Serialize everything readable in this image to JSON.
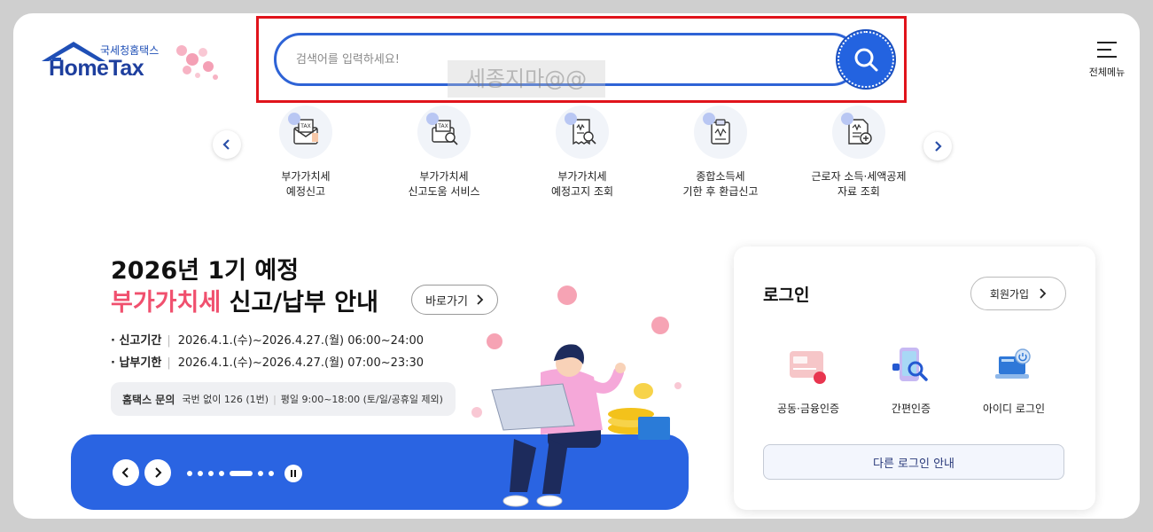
{
  "logo": {
    "sub": "국세청홈택스",
    "main": "HomeTax"
  },
  "search": {
    "placeholder": "검색어를 입력하세요!",
    "watermark": "세종지마@@"
  },
  "menu": {
    "label": "전체메뉴"
  },
  "quick_menu": [
    {
      "label": "부가가치세\n예정신고",
      "icon": "tax-envelope-icon"
    },
    {
      "label": "부가가치세\n신고도움 서비스",
      "icon": "tax-search-icon"
    },
    {
      "label": "부가가치세\n예정고지 조회",
      "icon": "receipt-search-icon"
    },
    {
      "label": "종합소득세\n기한 후 환급신고",
      "icon": "clipboard-icon"
    },
    {
      "label": "근로자 소득·세액공제\n자료 조회",
      "icon": "document-plus-icon"
    }
  ],
  "banner": {
    "title_line1": "2026년 1기 예정",
    "title_accent": "부가가치세",
    "title_rest": " 신고/납부 안내",
    "shortcut_label": "바로가기",
    "report_period_label": "신고기간",
    "report_period_value": "2026.4.1.(수)~2026.4.27.(월) 06:00~24:00",
    "payment_period_label": "납부기한",
    "payment_period_value": "2026.4.1.(수)~2026.4.27.(월) 07:00~23:30",
    "contact_title": "홈택스 문의",
    "contact_number": "국번 없이 126 (1번)",
    "contact_hours": "평일 9:00~18:00 (토/일/공휴일 제외)",
    "slide_count": 7,
    "active_slide": 5
  },
  "login": {
    "title": "로그인",
    "signup_label": "회원가입",
    "options": [
      {
        "label": "공동·금융인증",
        "icon": "certificate-icon"
      },
      {
        "label": "간편인증",
        "icon": "phone-search-icon"
      },
      {
        "label": "아이디 로그인",
        "icon": "laptop-power-icon"
      }
    ],
    "other_login_label": "다른 로그인 안내"
  },
  "colors": {
    "primary": "#2a64e2",
    "accent": "#f0506e",
    "highlight": "#e0131b"
  }
}
